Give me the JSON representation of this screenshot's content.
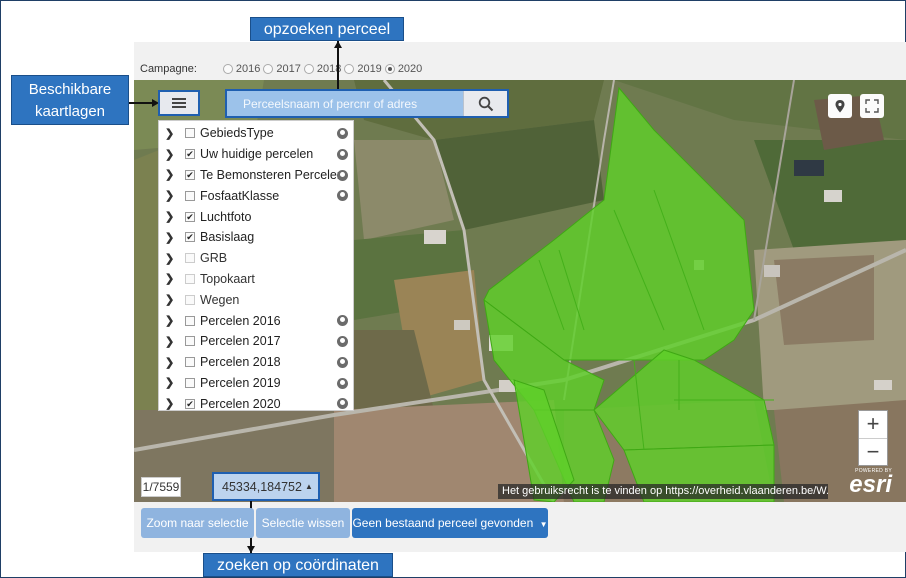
{
  "annotations": {
    "search_callout": "opzoeken perceel",
    "layers_callout_line1": "Beschikbare",
    "layers_callout_line2": "kaartlagen",
    "coords_callout": "zoeken op coördinaten"
  },
  "campaign": {
    "label": "Campagne:",
    "options": [
      "2016",
      "2017",
      "2018",
      "2019",
      "2020"
    ],
    "selected": "2020"
  },
  "search": {
    "placeholder": "Perceelsnaam of percnr of adres",
    "button_icon": "search-icon"
  },
  "layers_button_icon": "list-icon",
  "layers": [
    {
      "label": "GebiedsType",
      "checked": false,
      "globe": true,
      "dim": false
    },
    {
      "label": "Uw huidige percelen",
      "checked": true,
      "globe": true,
      "dim": false
    },
    {
      "label": "Te Bemonsteren Percelen",
      "checked": true,
      "globe": true,
      "dim": false
    },
    {
      "label": "FosfaatKlasse",
      "checked": false,
      "globe": true,
      "dim": false
    },
    {
      "label": "Luchtfoto",
      "checked": true,
      "globe": false,
      "dim": false
    },
    {
      "label": "Basislaag",
      "checked": true,
      "globe": false,
      "dim": false
    },
    {
      "label": "GRB",
      "checked": false,
      "globe": false,
      "dim": true
    },
    {
      "label": "Topokaart",
      "checked": false,
      "globe": false,
      "dim": true
    },
    {
      "label": "Wegen",
      "checked": false,
      "globe": false,
      "dim": true
    },
    {
      "label": "Percelen 2016",
      "checked": false,
      "globe": true,
      "dim": false
    },
    {
      "label": "Percelen 2017",
      "checked": false,
      "globe": true,
      "dim": false
    },
    {
      "label": "Percelen 2018",
      "checked": false,
      "globe": true,
      "dim": false
    },
    {
      "label": "Percelen 2019",
      "checked": false,
      "globe": true,
      "dim": false
    },
    {
      "label": "Percelen 2020",
      "checked": true,
      "globe": true,
      "dim": false
    }
  ],
  "map_controls": {
    "locate_icon": "location-pin-icon",
    "fullscreen_icon": "fullscreen-icon",
    "zoom_in": "+",
    "zoom_out": "−",
    "esri_powered": "POWERED BY",
    "esri_logo": "esri"
  },
  "attribution": "Het gebruiksrecht is te vinden op https://overheid.vlaanderen.be/W...",
  "counter": "1/7559",
  "coordinates": "45334,184752",
  "buttons": {
    "zoom_selection": "Zoom naar selectie",
    "clear_selection": "Selectie wissen",
    "no_parcel": "Geen bestaand perceel gevonden"
  },
  "colors": {
    "callout": "#2e74c0",
    "parcel_green": "#5fd02a",
    "primary_button": "#2e74c0",
    "disabled_button": "#8fb4df"
  }
}
